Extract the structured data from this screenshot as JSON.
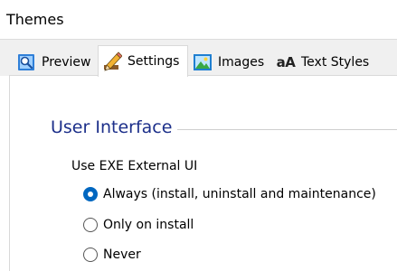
{
  "window": {
    "title": "Themes"
  },
  "tabs": [
    {
      "label": "Preview",
      "icon": "preview-icon",
      "active": false
    },
    {
      "label": "Settings",
      "icon": "pencil-icon",
      "active": true
    },
    {
      "label": "Images",
      "icon": "image-icon",
      "active": false
    },
    {
      "label": "Text Styles",
      "icon": "text-styles-icon",
      "icon_text": "aA",
      "active": false
    }
  ],
  "section": {
    "title": "User Interface"
  },
  "ui_option": {
    "label": "Use EXE External UI",
    "options": [
      {
        "label": "Always (install, uninstall and maintenance)",
        "selected": true
      },
      {
        "label": "Only on install",
        "selected": false
      },
      {
        "label": "Never",
        "selected": false
      }
    ]
  },
  "colors": {
    "accent": "#0067c0",
    "section_title": "#1c2f8a",
    "tab_strip": "#f0f0f0"
  }
}
